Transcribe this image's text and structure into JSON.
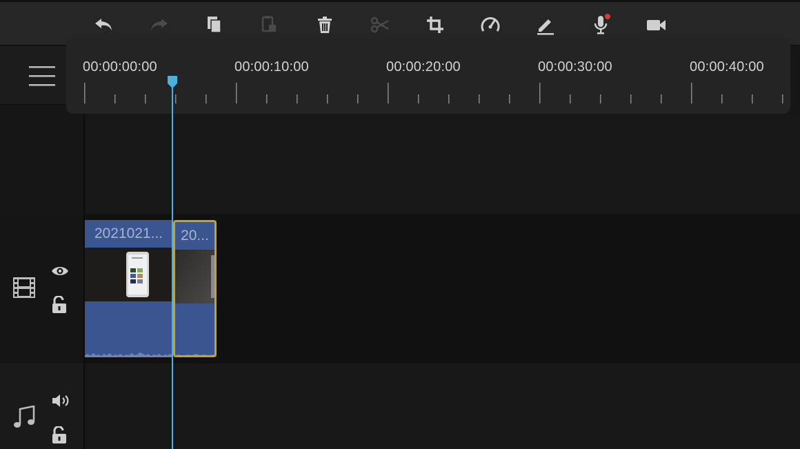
{
  "toolbar": {
    "buttons": [
      {
        "name": "undo",
        "icon": "undo-icon",
        "enabled": true
      },
      {
        "name": "redo",
        "icon": "redo-icon",
        "enabled": false
      },
      {
        "name": "copy",
        "icon": "copy-icon",
        "enabled": true
      },
      {
        "name": "paste",
        "icon": "paste-icon",
        "enabled": false
      },
      {
        "name": "delete",
        "icon": "trash-icon",
        "enabled": true
      },
      {
        "name": "split",
        "icon": "scissors-icon",
        "enabled": false
      },
      {
        "name": "crop",
        "icon": "crop-icon",
        "enabled": true
      },
      {
        "name": "speed",
        "icon": "speedometer-icon",
        "enabled": true
      },
      {
        "name": "edit",
        "icon": "pen-icon",
        "enabled": true
      },
      {
        "name": "voiceover",
        "icon": "microphone-icon",
        "enabled": true,
        "badge_color": "#d83a3a"
      },
      {
        "name": "record",
        "icon": "camera-icon",
        "enabled": true
      }
    ]
  },
  "ruler": {
    "labels": [
      "00:00:00:00",
      "00:00:10:00",
      "00:00:20:00",
      "00:00:30:00",
      "00:00:40:00"
    ]
  },
  "playhead": {
    "color": "#4fb0e0"
  },
  "tracks": {
    "video": {
      "icon": "film-icon",
      "visibility_icon": "eye-icon",
      "lock_icon": "unlock-icon"
    },
    "audio": {
      "icon": "music-note-icon",
      "volume_icon": "speaker-icon",
      "lock_icon": "unlock-icon"
    }
  },
  "clips": [
    {
      "title": "2021021...",
      "color": "#3a5590"
    },
    {
      "title": "20...",
      "color": "#3a5590",
      "selected": true,
      "border_color": "#c7a324"
    }
  ]
}
